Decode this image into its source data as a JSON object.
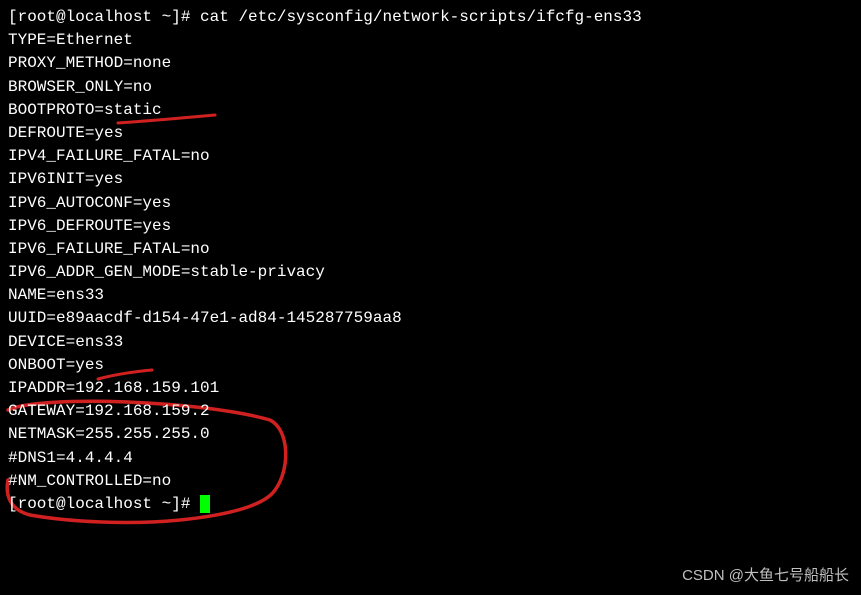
{
  "terminal": {
    "prompt1": "[root@localhost ~]# ",
    "command1": "cat /etc/sysconfig/network-scripts/ifcfg-ens33",
    "lines": [
      "TYPE=Ethernet",
      "PROXY_METHOD=none",
      "BROWSER_ONLY=no",
      "BOOTPROTO=static",
      "DEFROUTE=yes",
      "IPV4_FAILURE_FATAL=no",
      "IPV6INIT=yes",
      "IPV6_AUTOCONF=yes",
      "IPV6_DEFROUTE=yes",
      "IPV6_FAILURE_FATAL=no",
      "IPV6_ADDR_GEN_MODE=stable-privacy",
      "NAME=ens33",
      "UUID=e89aacdf-d154-47e1-ad84-145287759aa8",
      "DEVICE=ens33",
      "ONBOOT=yes",
      "",
      "IPADDR=192.168.159.101",
      "GATEWAY=192.168.159.2",
      "NETMASK=255.255.255.0",
      "#DNS1=4.4.4.4",
      "#NM_CONTROLLED=no"
    ],
    "prompt2": "[root@localhost ~]# "
  },
  "watermark": "CSDN @大鱼七号船船长"
}
